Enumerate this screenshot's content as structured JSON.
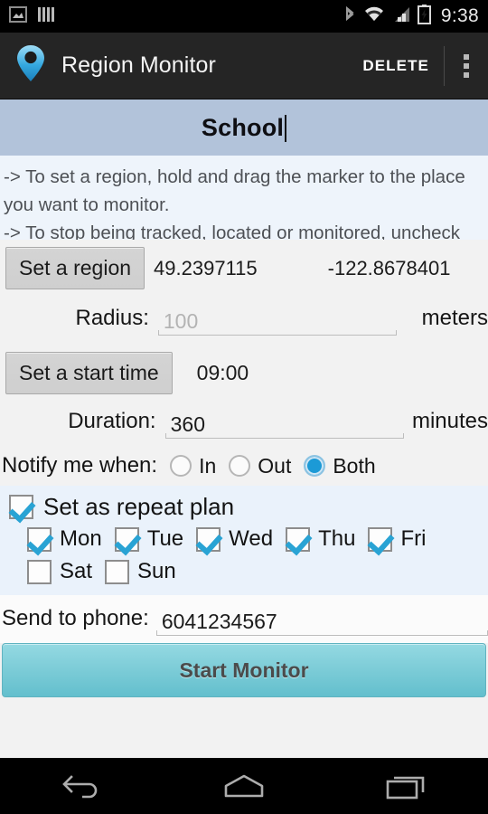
{
  "statusbar": {
    "icons_left": [
      "image-icon",
      "bars-icon"
    ],
    "icons_right": [
      "bluetooth-icon",
      "wifi-icon",
      "signal-icon",
      "battery-charging-icon"
    ],
    "clock": "9:38"
  },
  "actionbar": {
    "logo_icon": "map-pin-icon",
    "title": "Region Monitor",
    "delete_label": "DELETE",
    "overflow_icon": "overflow-menu-icon"
  },
  "title_band": {
    "name_value": "School"
  },
  "instructions": {
    "line1": "-> To set a region, hold and drag the marker to the place you want to monitor.",
    "line2": "-> To stop being tracked, located or monitored, uncheck the"
  },
  "region": {
    "set_region_label": "Set a region",
    "latitude": "49.2397115",
    "longitude": "-122.8678401",
    "radius_label": "Radius:",
    "radius_placeholder": "100",
    "radius_unit": "meters"
  },
  "schedule": {
    "set_start_time_label": "Set a start time",
    "start_time": "09:00",
    "duration_label": "Duration:",
    "duration_value": "360",
    "duration_unit": "minutes"
  },
  "notify": {
    "label": "Notify me when:",
    "options": [
      {
        "label": "In",
        "selected": false
      },
      {
        "label": "Out",
        "selected": false
      },
      {
        "label": "Both",
        "selected": true
      }
    ]
  },
  "repeat": {
    "label": "Set as repeat plan",
    "checked": true,
    "days": [
      {
        "label": "Mon",
        "checked": true
      },
      {
        "label": "Tue",
        "checked": true
      },
      {
        "label": "Wed",
        "checked": true
      },
      {
        "label": "Thu",
        "checked": true
      },
      {
        "label": "Fri",
        "checked": true
      },
      {
        "label": "Sat",
        "checked": false
      },
      {
        "label": "Sun",
        "checked": false
      }
    ]
  },
  "send": {
    "label": "Send to phone:",
    "phone_value": "6041234567"
  },
  "action": {
    "start_label": "Start Monitor"
  },
  "navbar": {
    "back_icon": "back-icon",
    "home_icon": "home-icon",
    "recents_icon": "recents-icon"
  },
  "colors": {
    "accent_blue": "#1c9ad6",
    "title_band": "#b2c3da",
    "instructions_bg": "#eef4fb",
    "start_button": "#7ecdd8"
  }
}
